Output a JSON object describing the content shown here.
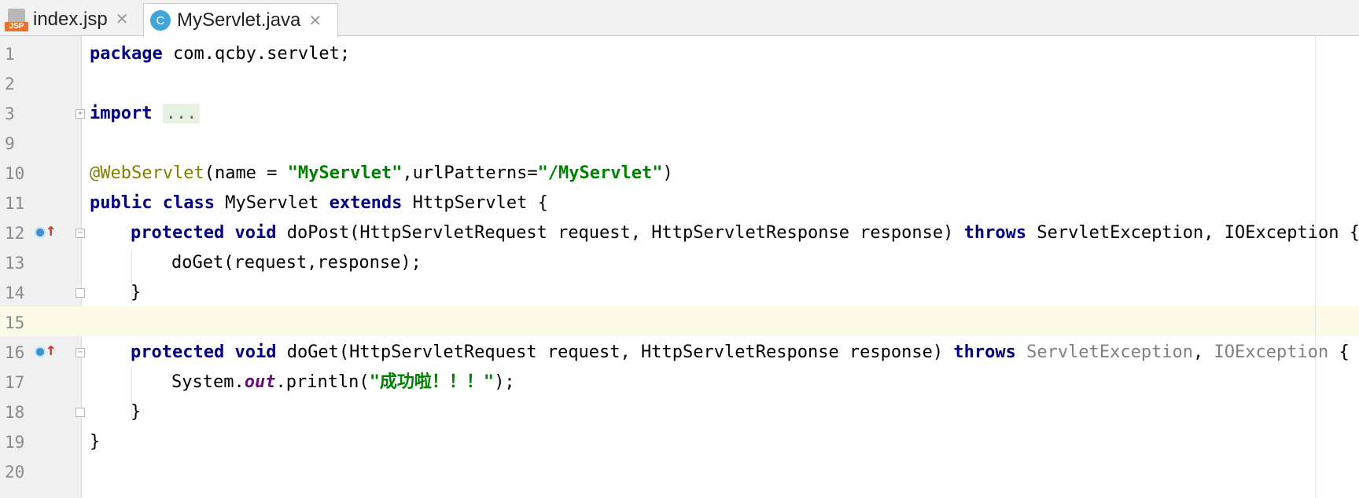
{
  "tabs": [
    {
      "label": "index.jsp",
      "icon": "jsp-file-icon",
      "active": false
    },
    {
      "label": "MyServlet.java",
      "icon": "java-class-icon",
      "active": true
    }
  ],
  "tab_icon_labels": {
    "jsp": "JSP",
    "class": "C"
  },
  "close_glyph": "✕",
  "editor": {
    "current_line": "15",
    "lines": [
      {
        "n": "1"
      },
      {
        "n": "2"
      },
      {
        "n": "3"
      },
      {
        "n": "9"
      },
      {
        "n": "10"
      },
      {
        "n": "11"
      },
      {
        "n": "12"
      },
      {
        "n": "13"
      },
      {
        "n": "14"
      },
      {
        "n": "15"
      },
      {
        "n": "16"
      },
      {
        "n": "17"
      },
      {
        "n": "18"
      },
      {
        "n": "19"
      },
      {
        "n": "20"
      }
    ],
    "tokens": {
      "l1_kw": "package",
      "l1_rest": " com.qcby.servlet;",
      "l3_kw": "import",
      "l3_fold": "...",
      "l10_ann": "@WebServlet",
      "l10_a": "(name = ",
      "l10_s1": "\"MyServlet\"",
      "l10_b": ",urlPatterns=",
      "l10_s2": "\"/MyServlet\"",
      "l10_c": ")",
      "l11_kw1": "public",
      "l11_kw2": "class",
      "l11_name": " MyServlet ",
      "l11_kw3": "extends",
      "l11_rest": " HttpServlet {",
      "l12_kw1": "protected",
      "l12_kw2": "void",
      "l12_a": " doPost(HttpServletRequest request, HttpServletResponse response) ",
      "l12_kw3": "throws",
      "l12_b": " ServletException, IOException {",
      "l13": "doGet(request,response);",
      "l14": "}",
      "l16_kw1": "protected",
      "l16_kw2": "void",
      "l16_a": " doGet(HttpServletRequest request, HttpServletResponse response) ",
      "l16_kw3": "throws",
      "l16_ex1": "ServletException",
      "l16_comma": ", ",
      "l16_ex2": "IOException",
      "l16_brace": " {",
      "l17_a": "System.",
      "l17_fld": "out",
      "l17_b": ".println(",
      "l17_s": "\"成功啦！！！\"",
      "l17_c": ");",
      "l18": "}",
      "l19": "}"
    }
  },
  "colors": {
    "keyword": "#000080",
    "string": "#008000",
    "annotation": "#808000",
    "static_field": "#660e7a",
    "unused": "#808080",
    "caret_row": "#fcfae6"
  }
}
